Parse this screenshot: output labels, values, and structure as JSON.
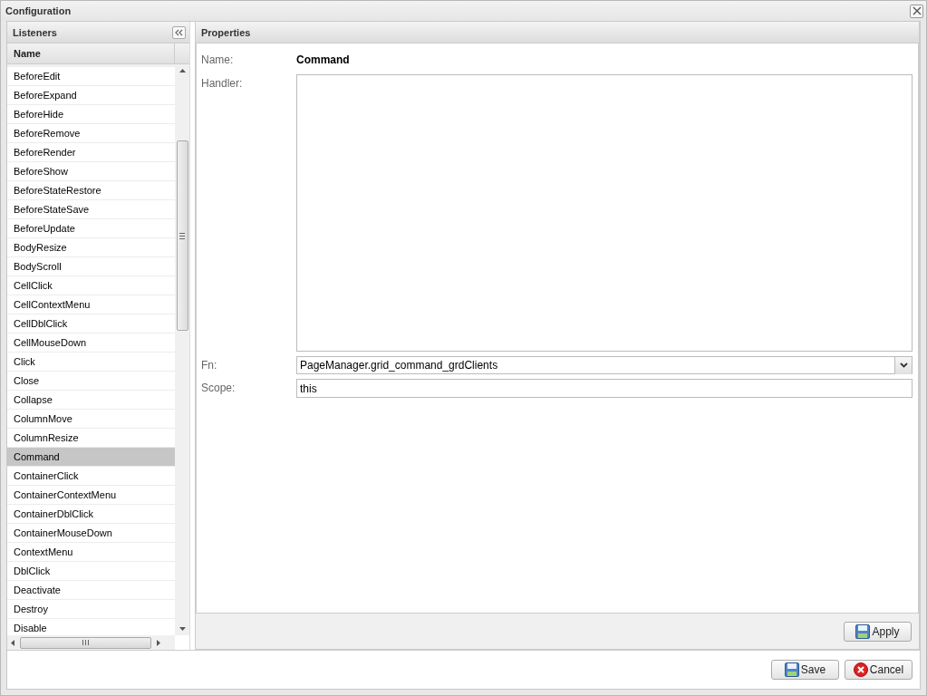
{
  "window": {
    "title": "Configuration"
  },
  "listeners": {
    "title": "Listeners",
    "column": "Name",
    "rows": [
      {
        "label": "BeforeEdit",
        "selected": false
      },
      {
        "label": "BeforeExpand",
        "selected": false
      },
      {
        "label": "BeforeHide",
        "selected": false
      },
      {
        "label": "BeforeRemove",
        "selected": false
      },
      {
        "label": "BeforeRender",
        "selected": false
      },
      {
        "label": "BeforeShow",
        "selected": false
      },
      {
        "label": "BeforeStateRestore",
        "selected": false
      },
      {
        "label": "BeforeStateSave",
        "selected": false
      },
      {
        "label": "BeforeUpdate",
        "selected": false
      },
      {
        "label": "BodyResize",
        "selected": false
      },
      {
        "label": "BodyScroll",
        "selected": false
      },
      {
        "label": "CellClick",
        "selected": false
      },
      {
        "label": "CellContextMenu",
        "selected": false
      },
      {
        "label": "CellDblClick",
        "selected": false
      },
      {
        "label": "CellMouseDown",
        "selected": false
      },
      {
        "label": "Click",
        "selected": false
      },
      {
        "label": "Close",
        "selected": false
      },
      {
        "label": "Collapse",
        "selected": false
      },
      {
        "label": "ColumnMove",
        "selected": false
      },
      {
        "label": "ColumnResize",
        "selected": false
      },
      {
        "label": "Command",
        "selected": true
      },
      {
        "label": "ContainerClick",
        "selected": false
      },
      {
        "label": "ContainerContextMenu",
        "selected": false
      },
      {
        "label": "ContainerDblClick",
        "selected": false
      },
      {
        "label": "ContainerMouseDown",
        "selected": false
      },
      {
        "label": "ContextMenu",
        "selected": false
      },
      {
        "label": "DblClick",
        "selected": false
      },
      {
        "label": "Deactivate",
        "selected": false
      },
      {
        "label": "Destroy",
        "selected": false
      },
      {
        "label": "Disable",
        "selected": false
      }
    ]
  },
  "properties": {
    "title": "Properties",
    "fields": [
      {
        "kind": "text",
        "label": "Name:",
        "value": "Command"
      },
      {
        "kind": "textarea",
        "label": "Handler:"
      },
      {
        "kind": "combo",
        "label": "Fn:",
        "value": "PageManager.grid_command_grdClients"
      },
      {
        "kind": "input",
        "label": "Scope:",
        "value": "this"
      }
    ],
    "apply": {
      "label": "Apply"
    }
  },
  "buttons": [
    {
      "kind": "save",
      "label": "Save"
    },
    {
      "kind": "cancel",
      "label": "Cancel"
    }
  ]
}
